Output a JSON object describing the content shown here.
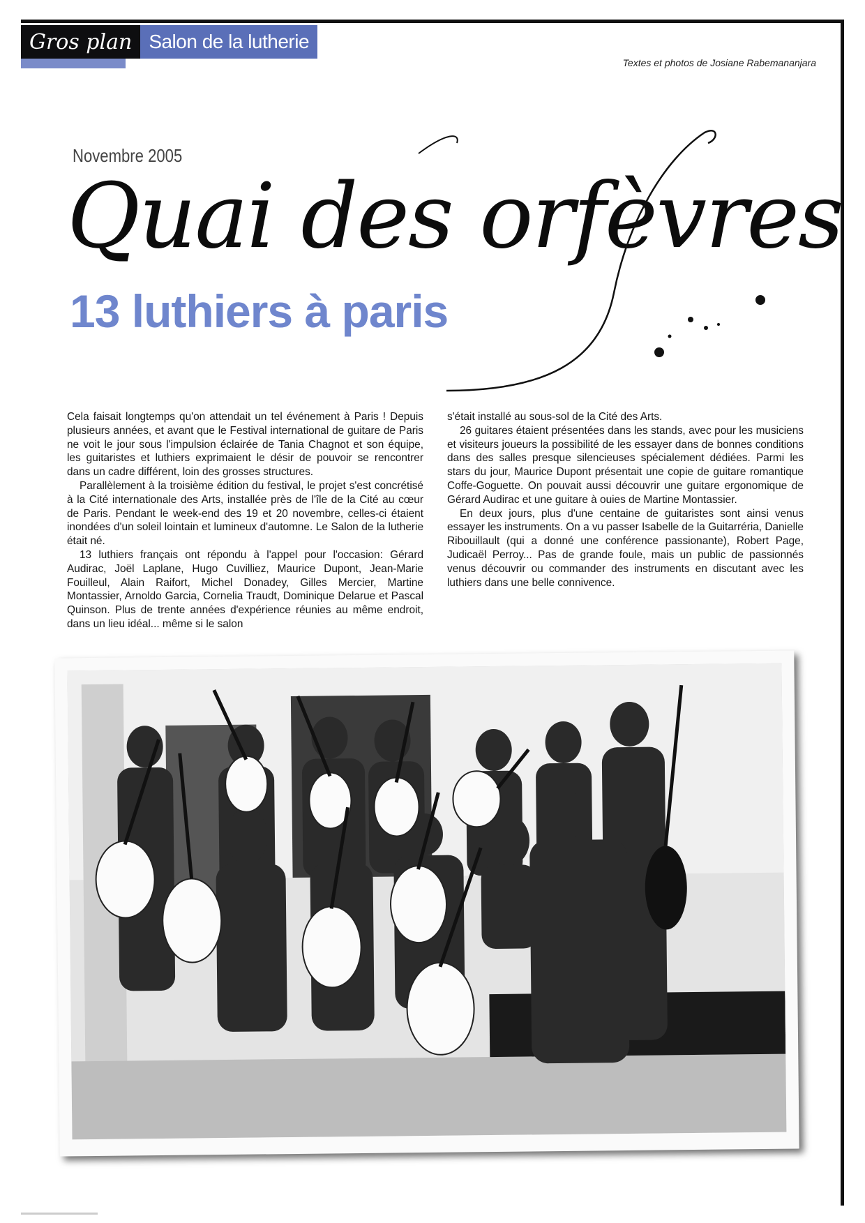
{
  "header": {
    "tag_italic": "Gros plan",
    "tag_section": "Salon de la lutherie",
    "credits": "Textes et photos de Josiane Rabemananjara"
  },
  "article": {
    "date": "Novembre 2005",
    "title": "Quai des orfèvres",
    "subtitle": "13 luthiers à paris",
    "col1": [
      "Cela faisait longtemps qu'on attendait un tel événement à Paris ! Depuis plusieurs années, et avant que le Festival international de guitare de Paris ne voit le jour sous l'impulsion éclairée de Tania Chagnot et son équipe, les guitaristes et luthiers exprimaient le désir de pouvoir se rencontrer dans un cadre différent, loin des grosses structures.",
      "Parallèlement à la troisième édition du festival, le projet s'est concrétisé à la Cité internationale des Arts, installée près de l'île de la Cité au cœur de Paris. Pendant le week-end des 19 et 20 novembre, celles-ci étaient inondées d'un soleil lointain et lumineux d'automne. Le Salon de la lutherie était né.",
      "13 luthiers français ont répondu à l'appel pour l'occasion: Gérard Audirac, Joël Laplane, Hugo Cuvilliez, Maurice Dupont, Jean-Marie Fouilleul, Alain Raifort, Michel Donadey, Gilles Mercier, Martine Montassier, Arnoldo Garcia, Cornelia Traudt, Dominique Delarue et Pascal Quinson. Plus de trente années d'expérience réunies au même endroit, dans un lieu idéal... même si le salon"
    ],
    "col2": [
      "s'était installé au sous-sol de la Cité des Arts.",
      "26 guitares étaient présentées dans les stands, avec pour les musiciens et visiteurs joueurs la possibilité de les essayer dans de bonnes conditions dans des salles presque silencieuses spécialement dédiées. Parmi les stars du jour, Maurice Dupont présentait une copie de guitare romantique Coffe-Goguette. On pouvait aussi découvrir une guitare ergonomique de Gérard Audirac et une guitare à ouies de Martine Montassier.",
      "En deux jours, plus d'une centaine de guitaristes sont ainsi venus essayer les instruments. On a vu passer Isabelle de la Guitarréria, Danielle Ribouillault (qui a donné une conférence passionante), Robert Page, Judicaël Perroy... Pas de grande foule, mais un public de passionnés venus découvrir ou commander des instruments en discutant avec les luthiers dans une belle connivence."
    ]
  },
  "colors": {
    "accent_blue": "#6f86cd",
    "tag_dark": "#0e0e10"
  }
}
